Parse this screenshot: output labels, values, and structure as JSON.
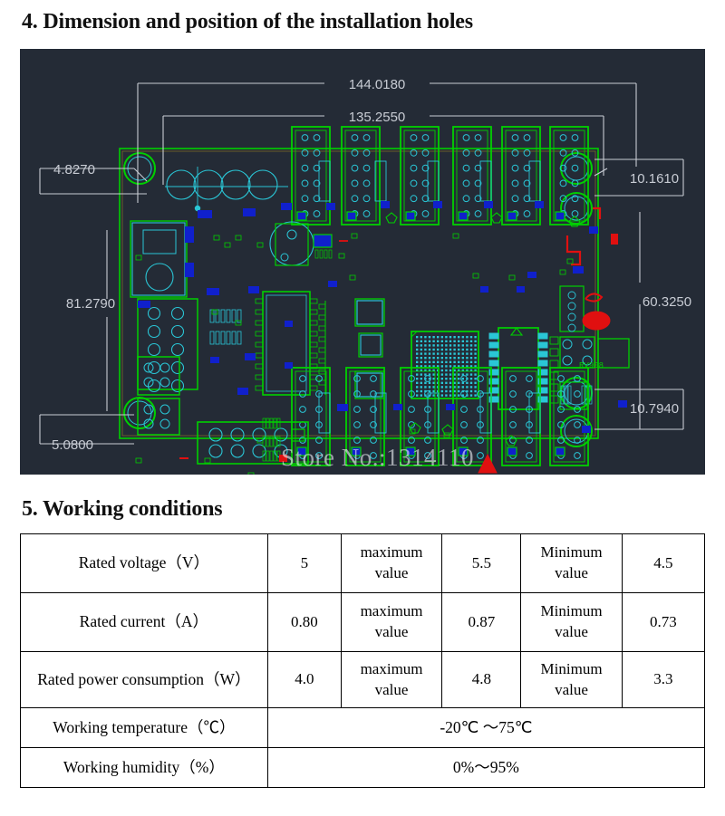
{
  "sections": {
    "four": {
      "title": "4. Dimension and position of the installation holes"
    },
    "five": {
      "title": "5. Working conditions"
    }
  },
  "diagram": {
    "name": "pcb-installation-hole-dimension-drawing",
    "background_color": "#242b36",
    "trace_color": "#00d000",
    "pad_color": "#2ac6d6",
    "fill_color": "#1020cc",
    "accent_color": "#e01010",
    "dimension_color": "#c8ccd4",
    "watermark": "Store No.:1314110",
    "silkscreen_label": "RV908",
    "dimensions": {
      "top_outer": "144.0180",
      "top_inner": "135.2550",
      "left_top": "4.8270",
      "left_middle": "81.2790",
      "left_bottom": "5.0800",
      "right_top": "10.1610",
      "right_middle": "60.3250",
      "right_bottom": "10.7940"
    }
  },
  "table": {
    "rows": [
      {
        "label": "Rated voltage（V）",
        "nominal": "5",
        "max_label": "maximum value",
        "max_value": "5.5",
        "min_label": "Minimum value",
        "min_value": "4.5"
      },
      {
        "label": "Rated current（A）",
        "nominal": "0.80",
        "max_label": "maximum value",
        "max_value": "0.87",
        "min_label": "Minimum value",
        "min_value": "0.73"
      },
      {
        "label": "Rated power consumption（W）",
        "nominal": "4.0",
        "max_label": "maximum value",
        "max_value": "4.8",
        "min_label": "Minimum value",
        "min_value": "3.3"
      }
    ],
    "span_rows": [
      {
        "label": "Working temperature（℃）",
        "value": "-20℃ ～75℃"
      },
      {
        "label": "Working humidity（%）",
        "value": "0%～95%"
      }
    ]
  }
}
